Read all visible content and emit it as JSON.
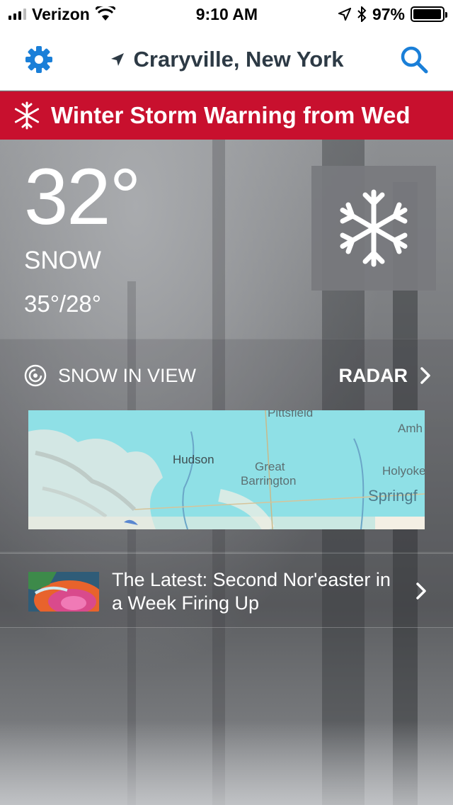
{
  "status_bar": {
    "carrier": "Verizon",
    "time": "9:10 AM",
    "battery": "97%",
    "battery_level": 0.97
  },
  "nav": {
    "location": "Craryville, New York",
    "settings_icon": "gear-icon",
    "location_icon": "location-arrow-icon",
    "search_icon": "search-icon"
  },
  "alert": {
    "text": "Winter Storm Warning from Wed",
    "icon": "snowflake-icon",
    "color": "#c8102e"
  },
  "current": {
    "temperature": "32°",
    "condition": "SNOW",
    "high_low": "35°/28°",
    "icon": "snowflake-icon"
  },
  "snow_in_view": {
    "label": "SNOW IN VIEW",
    "radar_label": "RADAR",
    "map_labels": {
      "pittsfield": "Pittsfield",
      "amherst": "Amh",
      "hudson": "Hudson",
      "great": "Great",
      "barrington": "Barrington",
      "holyoke": "Holyoke",
      "springfield": "Springf"
    }
  },
  "news": {
    "headline": "The Latest: Second Nor'easter in a Week Firing Up"
  },
  "colors": {
    "accent_blue": "#1a7fd8",
    "nav_text": "#2d3a45",
    "map_snow": "#8fe0e6"
  }
}
